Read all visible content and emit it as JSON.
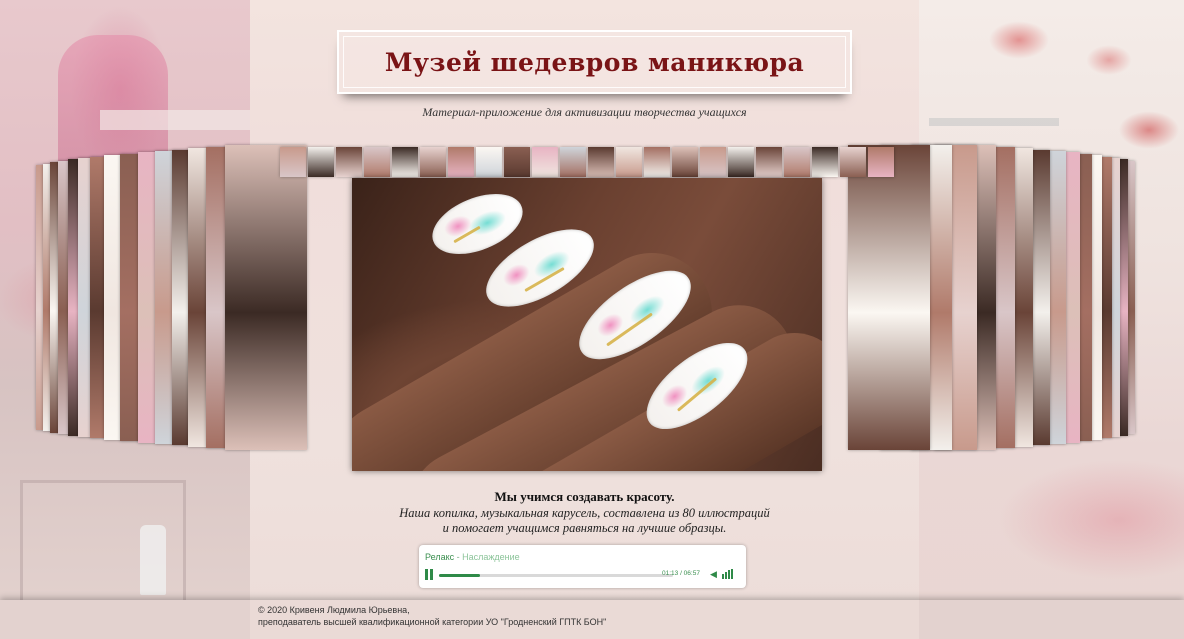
{
  "header": {
    "title": "Музей шедевров маникюра",
    "subtitle": "Материал-приложение для активизации творчества учащихся"
  },
  "carousel": {
    "photo_count": 80,
    "colors": {
      "title": "#7a1416",
      "accent_green": "#2f8a48"
    }
  },
  "caption": {
    "title": "Мы учимся создавать красоту.",
    "line1": "Наша копилка, музыкальная карусель, составлена из 80 иллюстраций",
    "line2": "и  помогает учащимся равняться на лучшие образцы."
  },
  "player": {
    "artist": "Релакс",
    "separator": " - ",
    "song": "Наслаждение",
    "time": "01:13 / 06:57",
    "progress": 0.175,
    "state": "playing",
    "play_icon": "pause-icon",
    "volume_icon": "speaker-icon"
  },
  "footer": {
    "line1": "© 2020 Кривеня Людмила Юрьевна,",
    "line2": "преподаватель высшей квалификационной категории  УО \"Гродненский ГПТК БОН\""
  }
}
